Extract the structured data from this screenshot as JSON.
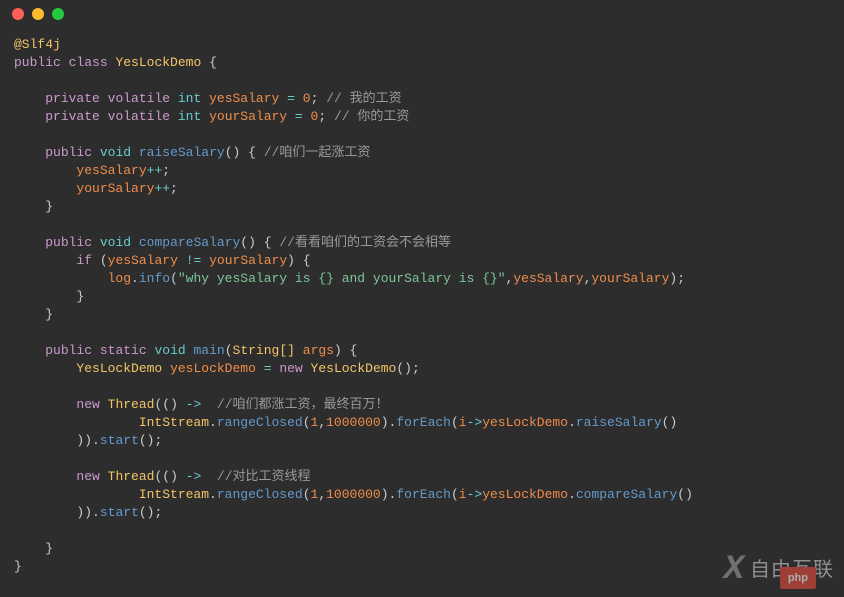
{
  "window": {
    "dots": [
      "close",
      "minimize",
      "zoom"
    ]
  },
  "code": {
    "annotation": "@Slf4j",
    "kw_public": "public",
    "kw_class": "class",
    "class_name": "YesLockDemo",
    "brace_open": "{",
    "brace_close": "}",
    "kw_private": "private",
    "kw_volatile": "volatile",
    "type_int": "int",
    "field_yesSalary": "yesSalary",
    "field_yourSalary": "yourSalary",
    "eq": "=",
    "zero": "0",
    "semi": ";",
    "comment_mySalary": "// 我的工资",
    "comment_yourSalary": "// 你的工资",
    "kw_void": "void",
    "method_raiseSalary": "raiseSalary",
    "parens": "()",
    "comment_raise": "//咱们一起涨工资",
    "pp": "++",
    "method_compareSalary": "compareSalary",
    "comment_compare": "//看看咱们的工资会不会相等",
    "kw_if": "if",
    "paren_open": "(",
    "paren_close": ")",
    "neq": "!=",
    "log": "log",
    "dot": ".",
    "method_info": "info",
    "string_why": "\"why yesSalary is {} and yourSalary is {}\"",
    "comma": ",",
    "kw_static": "static",
    "method_main": "main",
    "type_StringArr": "String[]",
    "arg_args": "args",
    "var_yesLockDemo": "yesLockDemo",
    "kw_new": "new",
    "class_Thread": "Thread",
    "arrow": "->",
    "comment_threadRaise": "//咱们都涨工资，最终百万！",
    "class_IntStream": "IntStream",
    "method_rangeClosed": "rangeClosed",
    "num_1": "1",
    "num_1000000": "1000000",
    "method_forEach": "forEach",
    "var_i": "i",
    "method_start": "start",
    "comment_threadCompare": "//对比工资线程"
  },
  "watermark": {
    "text": "自由互联",
    "badge": "php"
  }
}
